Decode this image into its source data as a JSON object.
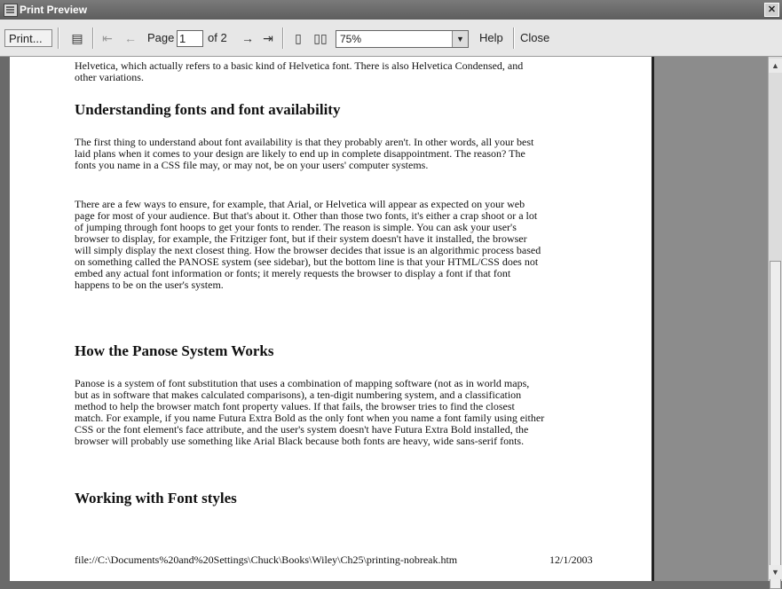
{
  "window": {
    "title": "Print Preview",
    "close_label": "✕"
  },
  "toolbar": {
    "print_label": "Print...",
    "page_label": "Page",
    "page_value": "1",
    "page_total": "of 2",
    "zoom_value": "75%",
    "help_label": "Help",
    "close_label": "Close"
  },
  "document": {
    "intro": "Helvetica, which actually refers to a basic kind of Helvetica font. There is also Helvetica Condensed, and other variations.",
    "h1": "Understanding fonts and font availability",
    "p1": "The first thing to understand about font availability is that they probably aren't. In other words, all your best laid plans when it comes to your design are likely to end up in complete disappointment. The reason? The fonts you name in a CSS file may, or may not, be on your users' computer systems.",
    "p2": "There are a few ways to ensure, for example, that Arial, or Helvetica will appear as expected on your web page for most of your audience. But that's about it. Other than those two fonts, it's either a crap shoot or a lot of jumping through font hoops to get your fonts to render. The reason is simple. You can ask your user's browser to display, for example, the Fritziger font, but if their system doesn't have it installed, the browser will simply display the next closest thing. How the browser decides that issue is an algorithmic process based on something called the PANOSE system (see sidebar), but the bottom line is that your HTML/CSS does not embed any actual font information or fonts; it merely requests the browser to display a font if that font happens to be on the user's system.",
    "h2": "How the Panose System Works",
    "p3": "Panose is a system of font substitution that uses a combination of mapping software (not as in world maps, but as in software that makes calculated comparisons), a ten-digit numbering system, and a classification method to help the browser match font property values. If that fails, the browser tries to find the closest match. For example, if you name Futura Extra Bold as the only font when you name a font family using either CSS or the font element's face attribute, and the user's system doesn't have Futura Extra Bold installed, the browser will probably use something like Arial Black because both fonts are heavy, wide sans-serif fonts.",
    "h3": "Working with Font styles",
    "footer_path": "file://C:\\Documents%20and%20Settings\\Chuck\\Books\\Wiley\\Ch25\\printing-nobreak.htm",
    "footer_date": "12/1/2003"
  }
}
